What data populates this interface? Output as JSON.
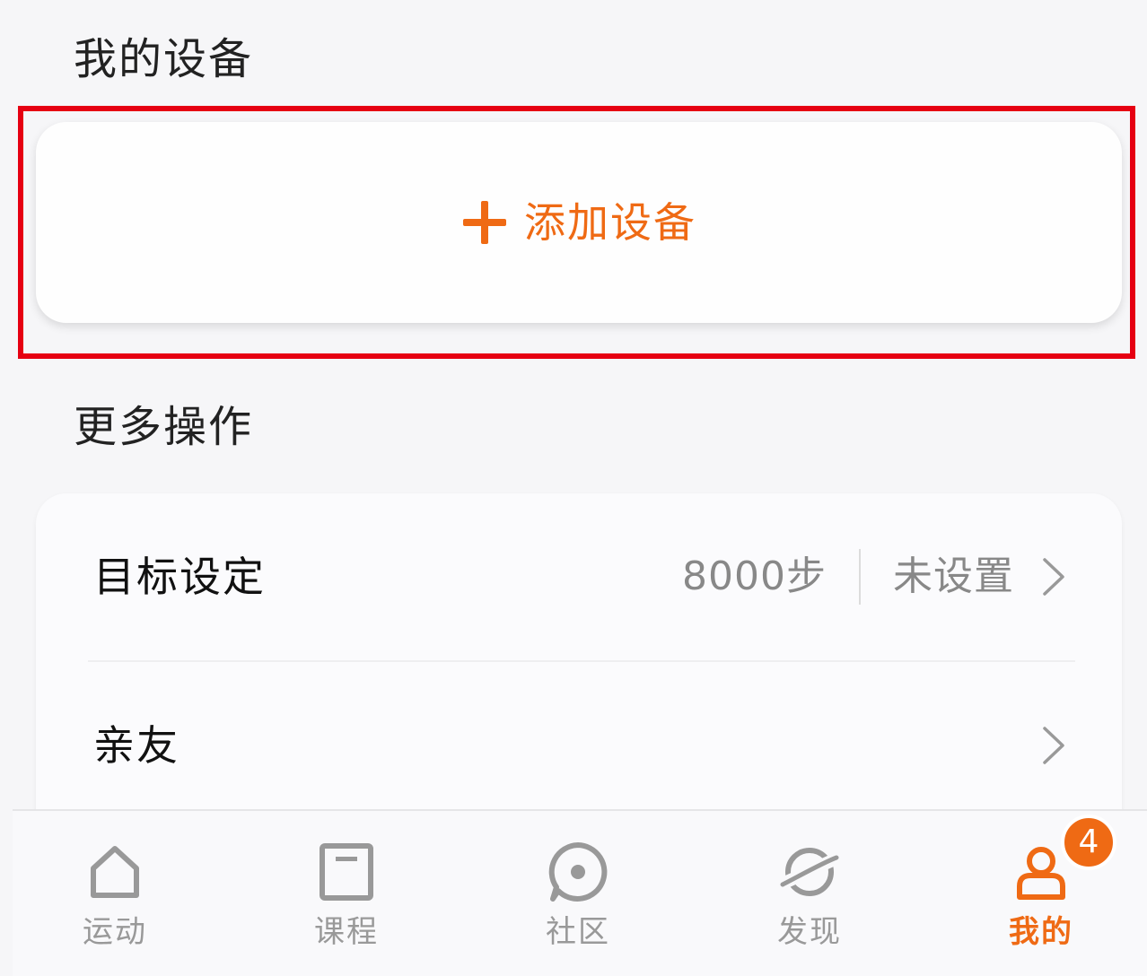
{
  "my_devices": {
    "title": "我的设备",
    "add_device_label": "添加设备"
  },
  "more_actions": {
    "title": "更多操作",
    "rows": [
      {
        "label": "目标设定",
        "value": "8000步",
        "status": "未设置"
      },
      {
        "label": "亲友"
      }
    ]
  },
  "tabbar": {
    "tabs": [
      {
        "label": "运动",
        "icon": "home-icon"
      },
      {
        "label": "课程",
        "icon": "course-icon"
      },
      {
        "label": "社区",
        "icon": "community-icon"
      },
      {
        "label": "发现",
        "icon": "planet-icon"
      },
      {
        "label": "我的",
        "icon": "user-icon",
        "active": true,
        "badge": "4"
      }
    ]
  },
  "colors": {
    "accent": "#ef6a14",
    "highlight_border": "#e60012",
    "inactive_tab": "#999999",
    "background": "#f6f6f8"
  }
}
